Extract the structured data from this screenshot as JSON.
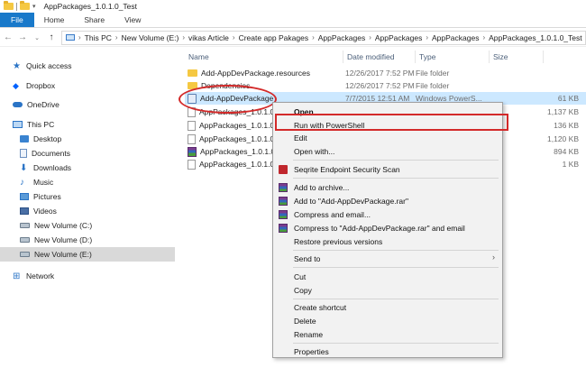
{
  "window": {
    "title": "AppPackages_1.0.1.0_Test"
  },
  "ribbon": {
    "tabs": [
      "File",
      "Home",
      "Share",
      "View"
    ]
  },
  "address": {
    "back_icon": "back-arrow-icon",
    "forward_icon": "forward-arrow-icon",
    "recent_icon": "chevron-down-icon",
    "up_icon": "up-arrow-icon",
    "breadcrumbs": [
      "This PC",
      "New Volume (E:)",
      "vikas Article",
      "Create app Pakages",
      "AppPackages",
      "AppPackages",
      "AppPackages",
      "AppPackages_1.0.1.0_Test"
    ]
  },
  "nav": {
    "items": [
      {
        "label": "Quick access",
        "icon": "star-icon"
      },
      {
        "label": "Dropbox",
        "icon": "dropbox-icon"
      },
      {
        "label": "OneDrive",
        "icon": "cloud-icon"
      },
      {
        "label": "This PC",
        "icon": "monitor-icon"
      },
      {
        "label": "Desktop",
        "icon": "folder-icon"
      },
      {
        "label": "Documents",
        "icon": "document-icon"
      },
      {
        "label": "Downloads",
        "icon": "download-icon"
      },
      {
        "label": "Music",
        "icon": "music-icon"
      },
      {
        "label": "Pictures",
        "icon": "picture-icon"
      },
      {
        "label": "Videos",
        "icon": "video-icon"
      },
      {
        "label": "New Volume (C:)",
        "icon": "drive-icon"
      },
      {
        "label": "New Volume (D:)",
        "icon": "drive-icon"
      },
      {
        "label": "New Volume (E:)",
        "icon": "drive-icon"
      },
      {
        "label": "Network",
        "icon": "network-icon"
      }
    ]
  },
  "columns": {
    "name": "Name",
    "date": "Date modified",
    "type": "Type",
    "size": "Size"
  },
  "files": [
    {
      "name": "Add-AppDevPackage.resources",
      "date": "12/26/2017 7:52 PM",
      "type": "File folder",
      "size": "",
      "icon": "folder-icon"
    },
    {
      "name": "Dependencies",
      "date": "12/26/2017 7:52 PM",
      "type": "File folder",
      "size": "",
      "icon": "folder-icon"
    },
    {
      "name": "Add-AppDevPackage",
      "date": "7/7/2015 12:51 AM",
      "type": "Windows PowerS...",
      "size": "61 KB",
      "icon": "powershell-file-icon"
    },
    {
      "name": "AppPackages_1.0.1.0_",
      "date": "",
      "type": "",
      "size": "1,137 KB",
      "icon": "file-icon"
    },
    {
      "name": "AppPackages_1.0.1.0_",
      "date": "",
      "type": "",
      "size": "136 KB",
      "icon": "file-icon"
    },
    {
      "name": "AppPackages_1.0.1.0_",
      "date": "",
      "type": "",
      "size": "1,120 KB",
      "icon": "file-icon"
    },
    {
      "name": "AppPackages_1.0.1.0_",
      "date": "",
      "type": "",
      "size": "894 KB",
      "icon": "winrar-icon"
    },
    {
      "name": "AppPackages_1.0.1.0_",
      "date": "",
      "type": "",
      "size": "1 KB",
      "icon": "file-icon"
    }
  ],
  "menu": {
    "open": "Open",
    "run_ps": "Run with PowerShell",
    "edit": "Edit",
    "open_with": "Open with...",
    "seqrite": "Seqrite Endpoint Security Scan",
    "add_archive": "Add to archive...",
    "add_rar": "Add to \"Add-AppDevPackage.rar\"",
    "compress_email": "Compress and email...",
    "compress_rar_email": "Compress to \"Add-AppDevPackage.rar\" and email",
    "restore": "Restore previous versions",
    "send_to": "Send to",
    "cut": "Cut",
    "copy": "Copy",
    "create_shortcut": "Create shortcut",
    "delete": "Delete",
    "rename": "Rename",
    "properties": "Properties",
    "submenu_icon": "chevron-right-icon"
  },
  "colors": {
    "file_tab": "#1979ca",
    "selection": "#cce8ff",
    "highlight": "#d32a2a"
  }
}
